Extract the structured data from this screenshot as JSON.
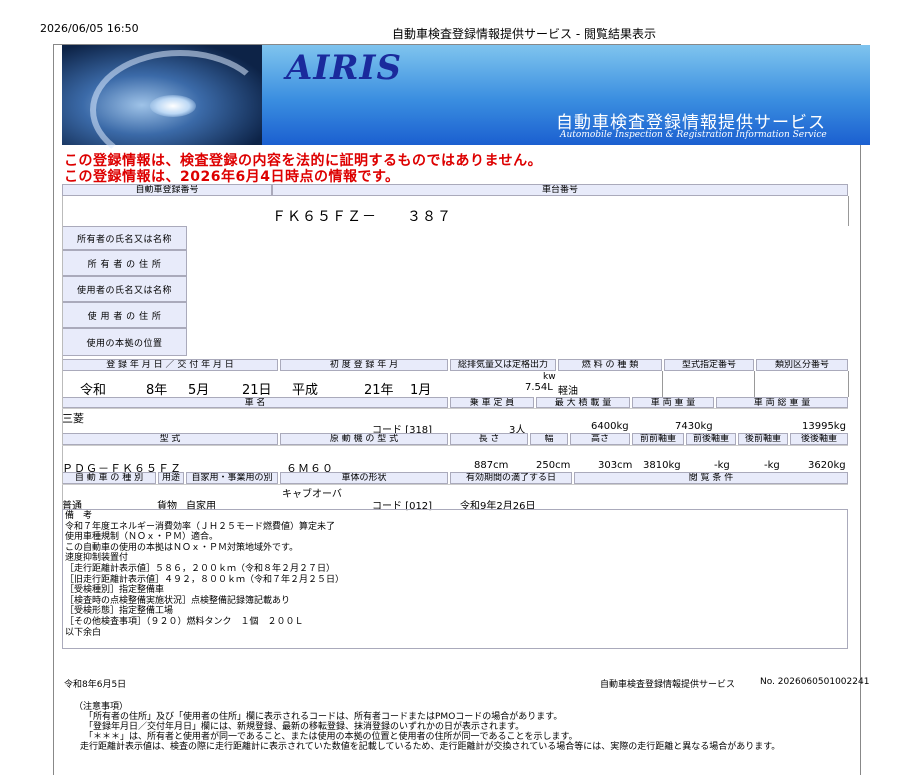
{
  "header": {
    "datetime": "2026/06/05 16:50",
    "title": "自動車検査登録情報提供サービス - 閲覧結果表示"
  },
  "banner": {
    "logo": "AIRIS",
    "service_jp": "自動車検査登録情報提供サービス",
    "service_en": "Automobile Inspection & Registration Information Service"
  },
  "warnings": [
    "この登録情報は、検査登録の内容を法的に証明するものではありません。",
    "この登録情報は、2026年6月4日時点の情報です。"
  ],
  "labels": {
    "reg_no": "自動車登録番号",
    "chassis_no": "車台番号",
    "owner_name": "所有者の氏名又は名称",
    "owner_addr": "所 有 者 の 住 所",
    "user_name": "使用者の氏名又は名称",
    "user_addr": "使 用 者 の 住 所",
    "base": "使用の本拠の位置",
    "reg_date": "登 録 年 月 日 ／ 交 付 年 月 日",
    "first_reg": "初 度 登 録 年 月",
    "displacement": "総排気量又は定格出力",
    "fuel": "燃 料 の 種 類",
    "model_no": "型式指定番号",
    "class_no": "類別区分番号",
    "car_name": "車 名",
    "capacity": "乗 車 定 員",
    "max_load": "最 大 積 載 量",
    "weight": "車 両 重 量",
    "gross": "車 両 総 重 量",
    "model": "型 式",
    "engine": "原 動 機 の 型 式",
    "length": "長 さ",
    "width": "幅",
    "height": "高さ",
    "ff_axle": "前前軸重",
    "fr_axle": "前後軸重",
    "rf_axle": "後前軸重",
    "rr_axle": "後後軸重",
    "kind": "自 動 車 の 種 別",
    "use": "用途",
    "purpose": "自家用・事業用の別",
    "shape": "車体の形状",
    "expiry": "有効期間の満了する日",
    "browse": "閲 覧 条 件"
  },
  "values": {
    "chassis_no": "ＦＫ６５ＦＺ－　　３８７",
    "reg_date": [
      "令和",
      "8年",
      "5月",
      "21日"
    ],
    "first_reg": [
      "平成",
      "21年",
      "1月"
    ],
    "displacement_unit": "kw",
    "displacement": "7.54L",
    "fuel": "軽油",
    "car_name": "三菱",
    "car_code": "コード [318]",
    "capacity": "3人",
    "max_load": "6400kg",
    "weight": "7430kg",
    "gross": "13995kg",
    "model": "ＰＤＧ－ＦＫ６５ＦＺ",
    "engine": "６Ｍ６０",
    "length": "887cm",
    "width": "250cm",
    "height": "303cm",
    "ff_axle": "3810kg",
    "fr_axle": "-kg",
    "rf_axle": "-kg",
    "rr_axle": "3620kg",
    "kind": "普通",
    "use": "貨物",
    "purpose": "自家用",
    "shape": "キャブオーバ",
    "shape_code": "コード [012]",
    "expiry": "令和9年2月26日"
  },
  "remarks": {
    "label": "備　考",
    "lines": [
      "令和７年度エネルギー消費効率（ＪＨ２５モード燃費値）算定未了",
      "使用車種規制（ＮＯｘ・ＰＭ）適合。",
      "この自動車の使用の本拠はＮＯｘ・ＰＭ対策地域外です。",
      "速度抑制装置付",
      "［走行距離計表示値］５８６，２００ｋｍ（令和８年２月２７日）",
      "［旧走行距離計表示値］４９２，８００ｋｍ（令和７年２月２５日）",
      "［受検種別］指定整備車",
      "［検査時の点検整備実施状況］点検整備記録簿記載あり",
      "［受検形態］指定整備工場",
      "［その他検査事項］（９２０）燃料タンク　１個　２００Ｌ",
      "以下余白"
    ]
  },
  "footer": {
    "date": "令和8年6月5日",
    "service": "自動車検査登録情報提供サービス",
    "number": "No. 2026060501002241"
  },
  "notes": {
    "title": "（注意事項）",
    "lines": [
      "「所有者の住所」及び「使用者の住所」欄に表示されるコードは、所有者コードまたはPMOコードの場合があります。",
      "「登録年月日／交付年月日」欄には、新規登録、最新の移転登録、抹消登録のいずれかの日が表示されます。",
      "「＊＊＊」は、所有者と使用者が同一であること、または使用の本拠の位置と使用者の住所が同一であることを示します。",
      "走行距離計表示値は、検査の際に走行距離計に表示されていた数値を記載しているため、走行距離計が交換されている場合等には、実際の走行距離と異なる場合があります。"
    ]
  }
}
